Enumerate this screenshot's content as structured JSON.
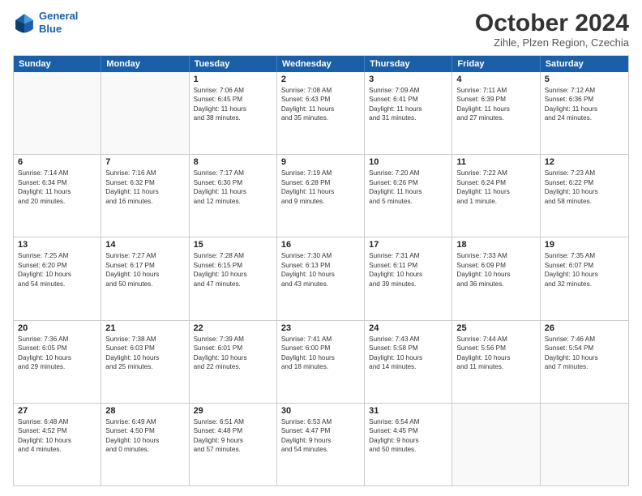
{
  "logo": {
    "line1": "General",
    "line2": "Blue"
  },
  "title": "October 2024",
  "subtitle": "Zihle, Plzen Region, Czechia",
  "header_days": [
    "Sunday",
    "Monday",
    "Tuesday",
    "Wednesday",
    "Thursday",
    "Friday",
    "Saturday"
  ],
  "weeks": [
    [
      {
        "day": "",
        "lines": [],
        "empty": true
      },
      {
        "day": "",
        "lines": [],
        "empty": true
      },
      {
        "day": "1",
        "lines": [
          "Sunrise: 7:06 AM",
          "Sunset: 6:45 PM",
          "Daylight: 11 hours",
          "and 38 minutes."
        ],
        "empty": false
      },
      {
        "day": "2",
        "lines": [
          "Sunrise: 7:08 AM",
          "Sunset: 6:43 PM",
          "Daylight: 11 hours",
          "and 35 minutes."
        ],
        "empty": false
      },
      {
        "day": "3",
        "lines": [
          "Sunrise: 7:09 AM",
          "Sunset: 6:41 PM",
          "Daylight: 11 hours",
          "and 31 minutes."
        ],
        "empty": false
      },
      {
        "day": "4",
        "lines": [
          "Sunrise: 7:11 AM",
          "Sunset: 6:39 PM",
          "Daylight: 11 hours",
          "and 27 minutes."
        ],
        "empty": false
      },
      {
        "day": "5",
        "lines": [
          "Sunrise: 7:12 AM",
          "Sunset: 6:36 PM",
          "Daylight: 11 hours",
          "and 24 minutes."
        ],
        "empty": false
      }
    ],
    [
      {
        "day": "6",
        "lines": [
          "Sunrise: 7:14 AM",
          "Sunset: 6:34 PM",
          "Daylight: 11 hours",
          "and 20 minutes."
        ],
        "empty": false
      },
      {
        "day": "7",
        "lines": [
          "Sunrise: 7:16 AM",
          "Sunset: 6:32 PM",
          "Daylight: 11 hours",
          "and 16 minutes."
        ],
        "empty": false
      },
      {
        "day": "8",
        "lines": [
          "Sunrise: 7:17 AM",
          "Sunset: 6:30 PM",
          "Daylight: 11 hours",
          "and 12 minutes."
        ],
        "empty": false
      },
      {
        "day": "9",
        "lines": [
          "Sunrise: 7:19 AM",
          "Sunset: 6:28 PM",
          "Daylight: 11 hours",
          "and 9 minutes."
        ],
        "empty": false
      },
      {
        "day": "10",
        "lines": [
          "Sunrise: 7:20 AM",
          "Sunset: 6:26 PM",
          "Daylight: 11 hours",
          "and 5 minutes."
        ],
        "empty": false
      },
      {
        "day": "11",
        "lines": [
          "Sunrise: 7:22 AM",
          "Sunset: 6:24 PM",
          "Daylight: 11 hours",
          "and 1 minute."
        ],
        "empty": false
      },
      {
        "day": "12",
        "lines": [
          "Sunrise: 7:23 AM",
          "Sunset: 6:22 PM",
          "Daylight: 10 hours",
          "and 58 minutes."
        ],
        "empty": false
      }
    ],
    [
      {
        "day": "13",
        "lines": [
          "Sunrise: 7:25 AM",
          "Sunset: 6:20 PM",
          "Daylight: 10 hours",
          "and 54 minutes."
        ],
        "empty": false
      },
      {
        "day": "14",
        "lines": [
          "Sunrise: 7:27 AM",
          "Sunset: 6:17 PM",
          "Daylight: 10 hours",
          "and 50 minutes."
        ],
        "empty": false
      },
      {
        "day": "15",
        "lines": [
          "Sunrise: 7:28 AM",
          "Sunset: 6:15 PM",
          "Daylight: 10 hours",
          "and 47 minutes."
        ],
        "empty": false
      },
      {
        "day": "16",
        "lines": [
          "Sunrise: 7:30 AM",
          "Sunset: 6:13 PM",
          "Daylight: 10 hours",
          "and 43 minutes."
        ],
        "empty": false
      },
      {
        "day": "17",
        "lines": [
          "Sunrise: 7:31 AM",
          "Sunset: 6:11 PM",
          "Daylight: 10 hours",
          "and 39 minutes."
        ],
        "empty": false
      },
      {
        "day": "18",
        "lines": [
          "Sunrise: 7:33 AM",
          "Sunset: 6:09 PM",
          "Daylight: 10 hours",
          "and 36 minutes."
        ],
        "empty": false
      },
      {
        "day": "19",
        "lines": [
          "Sunrise: 7:35 AM",
          "Sunset: 6:07 PM",
          "Daylight: 10 hours",
          "and 32 minutes."
        ],
        "empty": false
      }
    ],
    [
      {
        "day": "20",
        "lines": [
          "Sunrise: 7:36 AM",
          "Sunset: 6:05 PM",
          "Daylight: 10 hours",
          "and 29 minutes."
        ],
        "empty": false
      },
      {
        "day": "21",
        "lines": [
          "Sunrise: 7:38 AM",
          "Sunset: 6:03 PM",
          "Daylight: 10 hours",
          "and 25 minutes."
        ],
        "empty": false
      },
      {
        "day": "22",
        "lines": [
          "Sunrise: 7:39 AM",
          "Sunset: 6:01 PM",
          "Daylight: 10 hours",
          "and 22 minutes."
        ],
        "empty": false
      },
      {
        "day": "23",
        "lines": [
          "Sunrise: 7:41 AM",
          "Sunset: 6:00 PM",
          "Daylight: 10 hours",
          "and 18 minutes."
        ],
        "empty": false
      },
      {
        "day": "24",
        "lines": [
          "Sunrise: 7:43 AM",
          "Sunset: 5:58 PM",
          "Daylight: 10 hours",
          "and 14 minutes."
        ],
        "empty": false
      },
      {
        "day": "25",
        "lines": [
          "Sunrise: 7:44 AM",
          "Sunset: 5:56 PM",
          "Daylight: 10 hours",
          "and 11 minutes."
        ],
        "empty": false
      },
      {
        "day": "26",
        "lines": [
          "Sunrise: 7:46 AM",
          "Sunset: 5:54 PM",
          "Daylight: 10 hours",
          "and 7 minutes."
        ],
        "empty": false
      }
    ],
    [
      {
        "day": "27",
        "lines": [
          "Sunrise: 6:48 AM",
          "Sunset: 4:52 PM",
          "Daylight: 10 hours",
          "and 4 minutes."
        ],
        "empty": false
      },
      {
        "day": "28",
        "lines": [
          "Sunrise: 6:49 AM",
          "Sunset: 4:50 PM",
          "Daylight: 10 hours",
          "and 0 minutes."
        ],
        "empty": false
      },
      {
        "day": "29",
        "lines": [
          "Sunrise: 6:51 AM",
          "Sunset: 4:48 PM",
          "Daylight: 9 hours",
          "and 57 minutes."
        ],
        "empty": false
      },
      {
        "day": "30",
        "lines": [
          "Sunrise: 6:53 AM",
          "Sunset: 4:47 PM",
          "Daylight: 9 hours",
          "and 54 minutes."
        ],
        "empty": false
      },
      {
        "day": "31",
        "lines": [
          "Sunrise: 6:54 AM",
          "Sunset: 4:45 PM",
          "Daylight: 9 hours",
          "and 50 minutes."
        ],
        "empty": false
      },
      {
        "day": "",
        "lines": [],
        "empty": true
      },
      {
        "day": "",
        "lines": [],
        "empty": true
      }
    ]
  ]
}
